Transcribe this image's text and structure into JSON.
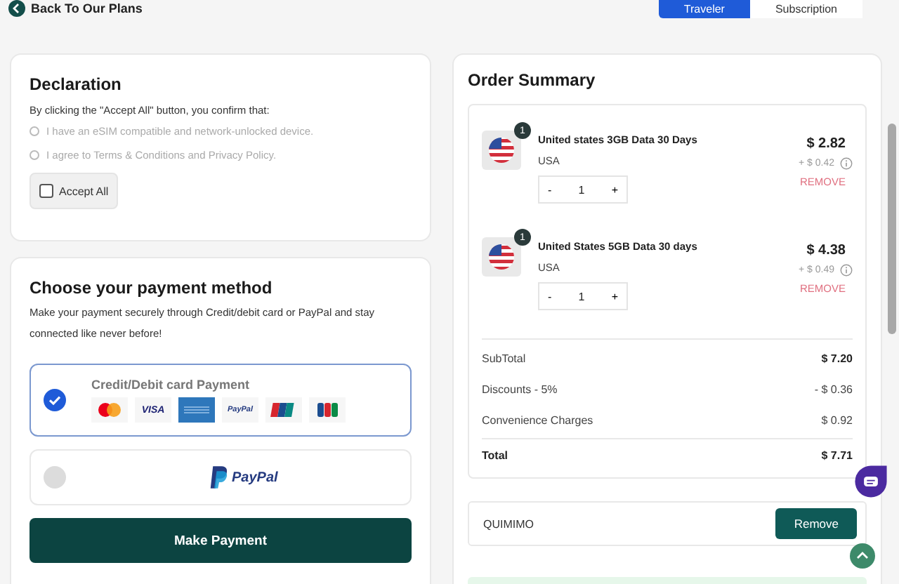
{
  "top_bar": {
    "back_link": "Back To Our Plans",
    "tabs": [
      {
        "label": "Traveler",
        "selected": true
      },
      {
        "label": "Subscription",
        "selected": false
      }
    ]
  },
  "declaration": {
    "title": "Declaration",
    "intro": "By clicking the \"Accept All\" button, you confirm that:",
    "items": [
      {
        "text": "I have an eSIM compatible and network-unlocked device.",
        "checked": false
      },
      {
        "text": "I agree to Terms & Conditions and Privacy Policy.",
        "checked": false
      }
    ],
    "accept_all": {
      "label": "Accept All",
      "checked": false
    }
  },
  "payment": {
    "title": "Choose your payment method",
    "description": "Make your payment securely through Credit/debit card or PayPal and stay connected like never before!",
    "methods": [
      {
        "kind": "card",
        "label": "Credit/Debit card Payment",
        "selected": true,
        "logos": [
          {
            "kind": "mastercard"
          },
          {
            "kind": "visa",
            "text": "VISA"
          },
          {
            "kind": "amex"
          },
          {
            "kind": "paypal",
            "text": "PayPal"
          },
          {
            "kind": "unionpay"
          },
          {
            "kind": "jcb"
          }
        ]
      },
      {
        "kind": "paypal",
        "label": "PayPal",
        "selected": false
      }
    ],
    "button": "Make Payment"
  },
  "order_summary": {
    "title": "Order Summary",
    "items": [
      {
        "badge": "1",
        "name": "United states 3GB Data 30 Days",
        "country": "USA",
        "minus": "-",
        "quantity": "1",
        "plus": "+",
        "price": "$ 2.82",
        "fee": "+ $ 0.42",
        "remove": "REMOVE"
      },
      {
        "badge": "1",
        "name": "United States 5GB Data 30 days",
        "country": "USA",
        "minus": "-",
        "quantity": "1",
        "plus": "+",
        "price": "$ 4.38",
        "fee": "+ $ 0.49",
        "remove": "REMOVE"
      }
    ],
    "totals": [
      {
        "kind": "subtotal",
        "label": "SubTotal",
        "value": "$ 7.20"
      },
      {
        "kind": "line",
        "label": "Discounts - 5%",
        "value": "- $ 0.36"
      },
      {
        "kind": "line",
        "label": "Convenience Charges",
        "value": "$ 0.92"
      },
      {
        "kind": "total",
        "label": "Total",
        "value": "$ 7.71"
      }
    ],
    "coupon": {
      "code": "QUIMIMO",
      "button": "Remove"
    }
  }
}
